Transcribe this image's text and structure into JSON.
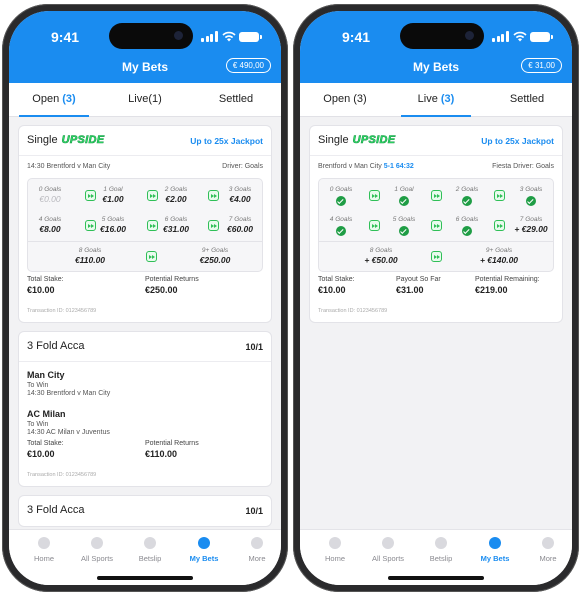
{
  "status": {
    "time": "9:41"
  },
  "header": {
    "title": "My Bets"
  },
  "colors": {
    "brand": "#1a8cf0",
    "upside_green": "#2fe06a",
    "tick_green": "#1f9d45"
  },
  "nav": [
    {
      "label": "Home",
      "icon": "home-icon"
    },
    {
      "label": "All Sports",
      "icon": "sports-icon"
    },
    {
      "label": "Betslip",
      "icon": "betslip-icon"
    },
    {
      "label": "My Bets",
      "icon": "mybets-icon"
    },
    {
      "label": "More",
      "icon": "more-icon"
    }
  ],
  "left": {
    "balance": "€ 490,00",
    "tabs": [
      {
        "label": "Open",
        "count": "(3)"
      },
      {
        "label": "Live",
        "count": "(1)"
      },
      {
        "label": "Settled",
        "count": ""
      }
    ],
    "single": {
      "type": "Single",
      "brand": "UPSIDE",
      "jackpot": "Up to 25x Jackpot",
      "fixture": "14:30 Brentford v Man City",
      "driver": "Driver: Goals",
      "rows": [
        [
          {
            "g": "0 Goals",
            "v": "€0.00"
          },
          {
            "g": "1 Goal",
            "v": "€1.00"
          },
          {
            "g": "2 Goals",
            "v": "€2.00"
          },
          {
            "g": "3 Goals",
            "v": "€4.00"
          }
        ],
        [
          {
            "g": "4 Goals",
            "v": "€8.00"
          },
          {
            "g": "5 Goals",
            "v": "€16.00"
          },
          {
            "g": "6 Goals",
            "v": "€31.00"
          },
          {
            "g": "7 Goals",
            "v": "€60.00"
          }
        ],
        [
          {
            "g": "8 Goals",
            "v": "€110.00"
          },
          {
            "g": "9+ Goals",
            "v": "€250.00"
          }
        ]
      ],
      "stake_label": "Total Stake:",
      "stake": "€10.00",
      "returns_label": "Potential Returns",
      "returns": "€250.00",
      "txid": "Transaction ID: 0123456789"
    },
    "acca1": {
      "title": "3 Fold Acca",
      "odds": "10/1",
      "selections": [
        {
          "team": "Man City",
          "market": "To Win",
          "fixture": "14:30 Brentford v Man City"
        },
        {
          "team": "AC Milan",
          "market": "To Win",
          "fixture": "14:30 AC Milan v Juventus"
        }
      ],
      "stake_label": "Total Stake:",
      "stake": "€10.00",
      "returns_label": "Potential Returns",
      "returns": "€110.00",
      "txid": "Transaction ID: 0123456789"
    },
    "acca2": {
      "title": "3 Fold Acca",
      "odds": "10/1"
    }
  },
  "right": {
    "balance": "€ 31,00",
    "tabs": [
      {
        "label": "Open",
        "count": "(3)"
      },
      {
        "label": "Live",
        "count": "(3)"
      },
      {
        "label": "Settled",
        "count": ""
      }
    ],
    "single": {
      "type": "Single",
      "brand": "UPSIDE",
      "jackpot": "Up to 25x Jackpot",
      "fixture": "Brentford v Man City",
      "score": "5-1",
      "minute": "64:32",
      "driver": "Fiesta Driver: Goals",
      "rows": [
        [
          {
            "g": "0 Goals",
            "done": true
          },
          {
            "g": "1 Goal",
            "done": true
          },
          {
            "g": "2 Goals",
            "done": true
          },
          {
            "g": "3 Goals",
            "done": true
          }
        ],
        [
          {
            "g": "4 Goals",
            "done": true
          },
          {
            "g": "5 Goals",
            "done": true
          },
          {
            "g": "6 Goals",
            "done": true
          },
          {
            "g": "7 Goals",
            "v": "+ €29.00"
          }
        ],
        [
          {
            "g": "8 Goals",
            "v": "+ €50.00"
          },
          {
            "g": "9+ Goals",
            "v": "+ €140.00"
          }
        ]
      ],
      "stake_label": "Total Stake:",
      "stake": "€10.00",
      "payout_label": "Payout So Far",
      "payout": "€31.00",
      "remaining_label": "Potential Remaining:",
      "remaining": "€219.00",
      "txid": "Transaction ID: 0123456789"
    }
  }
}
